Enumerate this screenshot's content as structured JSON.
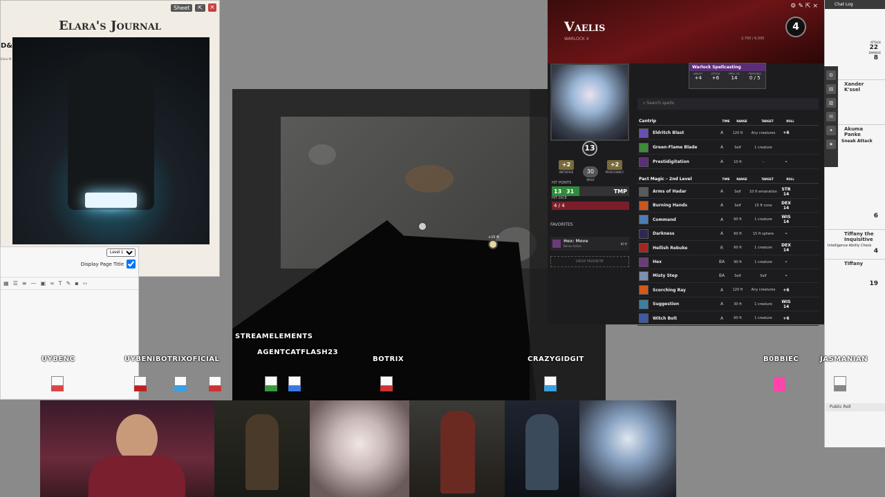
{
  "journal": {
    "title": "Elara's Journal",
    "sheet_btn": "Sheet",
    "level_select": "Level 1",
    "display_title_label": "Display Page Title",
    "side_letters": "D&",
    "side_small": "Elara W"
  },
  "sheet": {
    "name": "Vaelis",
    "class": "WARLOCK 4",
    "level": "4",
    "xp": "2,700 / 6,500",
    "ac": "13",
    "initiative": "+2",
    "initiative_label": "INITIATIVE",
    "proficiency": "+2",
    "proficiency_label": "PROFICIENCY",
    "speed": "30",
    "speed_label": "WALK",
    "hp_label": "HIT POINTS",
    "hp_current": "13",
    "hp_max": "31",
    "temp": "TMP",
    "hit_dice_label": "HIT DICE",
    "hit_dice": "4 / 4",
    "favorites_label": "FAVORITES",
    "fav_item": "Hex: Move",
    "fav_sub": "Bonus Action",
    "fav_range": "60 ft",
    "drop_favorite": "DROP FAVORITE",
    "spellcasting": {
      "title": "Warlock Spellcasting",
      "ability_label": "ABILITY",
      "ability": "+4",
      "attack_label": "ATTACK",
      "attack": "+6",
      "dc_label": "SPELL DC",
      "dc": "14",
      "prepared_label": "PREPARED",
      "prepared": "0 / 5"
    },
    "search_placeholder": "Search spells",
    "cantrip_header": "Cantrip",
    "pact_header": "Pact Magic – 2nd Level",
    "col_time": "TIME",
    "col_range": "RANGE",
    "col_target": "TARGET",
    "col_roll": "ROLL",
    "cantrips": [
      {
        "name": "Eldritch Blast",
        "time": "A",
        "range": "120 ft",
        "target": "Any creatures",
        "roll": "+6",
        "color": "#6a4fb3"
      },
      {
        "name": "Green-Flame Blade",
        "time": "A",
        "range": "Self",
        "target": "1 creature",
        "roll": "",
        "color": "#3f8a3a"
      },
      {
        "name": "Prestidigitation",
        "time": "A",
        "range": "10 ft",
        "target": "–",
        "roll": "–",
        "color": "#5a2e7a"
      }
    ],
    "pact_spells": [
      {
        "name": "Arms of Hadar",
        "time": "A",
        "range": "Self",
        "target": "10 ft emanation",
        "roll": "STR 14",
        "color": "#5a5a5a"
      },
      {
        "name": "Burning Hands",
        "time": "A",
        "range": "Self",
        "target": "15 ft cone",
        "roll": "DEX 14",
        "color": "#c8571f"
      },
      {
        "name": "Command",
        "time": "A",
        "range": "60 ft",
        "target": "1 creature",
        "roll": "WIS 14",
        "color": "#4a7db5"
      },
      {
        "name": "Darkness",
        "time": "A",
        "range": "60 ft",
        "target": "15 ft sphere",
        "roll": "–",
        "color": "#2d2a52"
      },
      {
        "name": "Hellish Rebuke",
        "time": "R",
        "range": "60 ft",
        "target": "1 creature",
        "roll": "DEX 14",
        "color": "#a3261f"
      },
      {
        "name": "Hex",
        "time": "BA",
        "range": "90 ft",
        "target": "1 creature",
        "roll": "–",
        "color": "#6b3b7a"
      },
      {
        "name": "Misty Step",
        "time": "BA",
        "range": "Self",
        "target": "Self",
        "roll": "–",
        "color": "#7f8fb0"
      },
      {
        "name": "Scorching Ray",
        "time": "A",
        "range": "120 ft",
        "target": "Any creatures",
        "roll": "+6",
        "color": "#d3591c"
      },
      {
        "name": "Suggestion",
        "time": "A",
        "range": "30 ft",
        "target": "1 creature",
        "roll": "WIS 14",
        "color": "#3e7fa1"
      },
      {
        "name": "Witch Bolt",
        "time": "A",
        "range": "60 ft",
        "target": "1 creature",
        "roll": "+6",
        "color": "#3e5aa3"
      }
    ]
  },
  "chat": {
    "title": "Chat Log",
    "attack_label": "ATTACK",
    "attack_val": "22",
    "damage_label": "DAMAGE",
    "damage_val": "8",
    "xander": "Xander K'ssel",
    "akuma": "Akuma Panke",
    "sneak": "Sneak Attack",
    "sneak_damage": "6",
    "tiffany": "Tiffany the Inquisitive",
    "int_check": "Intelligence Ability Check",
    "tiffany_val": "4",
    "tiffany2": "Tiffany",
    "init_val": "19",
    "public_roll": "Public Roll"
  },
  "players": [
    "UYBENC",
    "UYBENIBOTRIXOFICIAL",
    "STREAMELEMENTS",
    "AGENTCATFLASH23",
    "BOTRIX",
    "CRAZYGIDGIT",
    "B0BBIEC",
    "JASMANIAN"
  ],
  "map": {
    "token_label": "+15 ft"
  }
}
